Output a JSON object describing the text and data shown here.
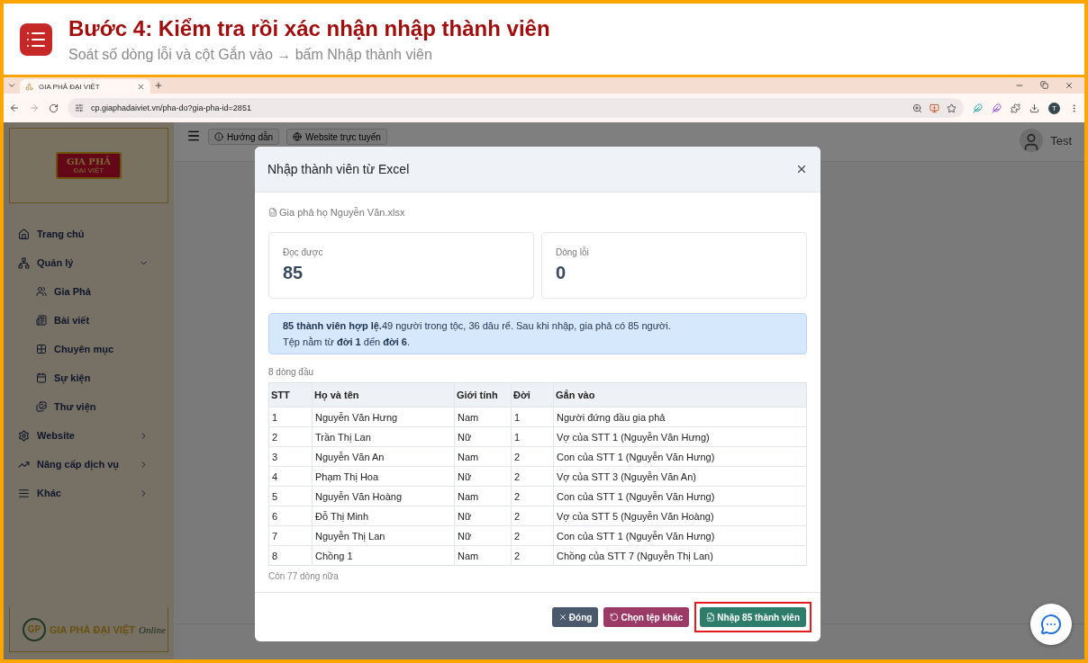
{
  "guide": {
    "title": "Bước 4: Kiểm tra rồi xác nhận nhập thành viên",
    "subtitle": "Soát số dòng lỗi và cột Gắn vào → bấm Nhập thành viên"
  },
  "browser": {
    "tab_title": "GIA PHẢ ĐẠI VIỆT",
    "url": "cp.giaphadaiviet.vn/pha-do?gia-pha-id=2851",
    "profile_initial": "T"
  },
  "sidebar": {
    "logo_top": [
      "GIA PHẢ",
      "ĐẠI VIỆT"
    ],
    "items": [
      {
        "label": "Trang chủ"
      },
      {
        "label": "Quản lý",
        "expanded": true,
        "children": [
          {
            "label": "Gia Phả"
          },
          {
            "label": "Bài viết"
          },
          {
            "label": "Chuyên mục"
          },
          {
            "label": "Sự kiện"
          },
          {
            "label": "Thư viện"
          }
        ]
      },
      {
        "label": "Website",
        "expanded": false
      },
      {
        "label": "Nâng cấp dịch vụ",
        "expanded": false
      },
      {
        "label": "Khác",
        "expanded": false
      }
    ],
    "logo_bottom": {
      "mark": "GP",
      "name": "GIA PHẢ ĐẠI VIỆT",
      "tag": "Online"
    }
  },
  "topbar": {
    "buttons": [
      "Hướng dẫn",
      "Website trực tuyến"
    ],
    "user": "Test"
  },
  "modal": {
    "title": "Nhập thành viên từ Excel",
    "file_name": "Gia phả họ Nguyễn Văn.xlsx",
    "stats": [
      {
        "label": "Đọc được",
        "value": "85"
      },
      {
        "label": "Dòng lỗi",
        "value": "0"
      }
    ],
    "alert": [
      "**85 thành viên hợp lệ.**49 người trong tộc, 36 dâu rể. Sau khi nhập, gia phả có 85 người.",
      "Tệp nằm từ **đời 1** đến **đời 6**."
    ],
    "preview_caption": "8 dòng đầu",
    "columns": [
      "STT",
      "Họ và tên",
      "Giới tính",
      "Đời",
      "Gắn vào"
    ],
    "rows": [
      [
        "1",
        "Nguyễn Văn Hưng",
        "Nam",
        "1",
        "Người đứng đầu gia phả"
      ],
      [
        "2",
        "Trần Thị Lan",
        "Nữ",
        "1",
        "Vợ của STT 1 (Nguyễn Văn Hưng)"
      ],
      [
        "3",
        "Nguyễn Văn An",
        "Nam",
        "2",
        "Con của STT 1 (Nguyễn Văn Hưng)"
      ],
      [
        "4",
        "Phạm Thị Hoa",
        "Nữ",
        "2",
        "Vợ của STT 3 (Nguyễn Văn An)"
      ],
      [
        "5",
        "Nguyễn Văn Hoàng",
        "Nam",
        "2",
        "Con của STT 1 (Nguyễn Văn Hưng)"
      ],
      [
        "6",
        "Đỗ Thị Minh",
        "Nữ",
        "2",
        "Vợ của STT 5 (Nguyễn Văn Hoàng)"
      ],
      [
        "7",
        "Nguyễn Thị Lan",
        "Nữ",
        "2",
        "Con của STT 1 (Nguyễn Văn Hưng)"
      ],
      [
        "8",
        "Chồng 1",
        "Nam",
        "2",
        "Chồng của STT 7 (Nguyễn Thị Lan)"
      ]
    ],
    "remaining": "Còn 77 dòng nữa",
    "buttons": [
      {
        "label": "Đóng",
        "kind": "close",
        "highlighted": false
      },
      {
        "label": "Chọn tệp khác",
        "kind": "reset",
        "highlighted": false
      },
      {
        "label": "Nhập 85 thành viên",
        "kind": "import",
        "highlighted": true
      }
    ]
  }
}
